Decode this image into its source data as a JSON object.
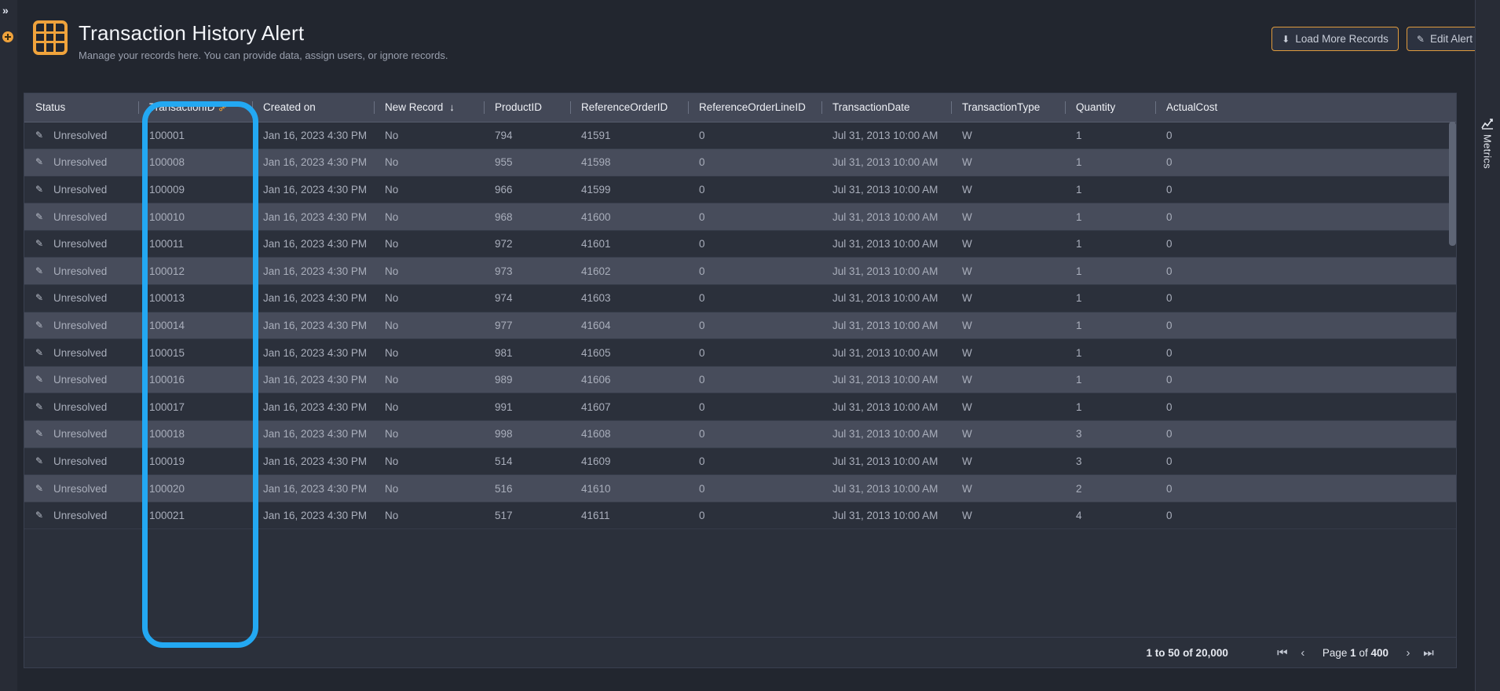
{
  "rail": {
    "expand_icon": "double-chevron-right",
    "expand_glyph": "»",
    "add_icon": "plus-circle"
  },
  "header": {
    "logo_icon": "grid-table-icon",
    "title": "Transaction History Alert",
    "subtitle": "Manage your records here. You can provide data, assign users, or ignore records.",
    "buttons": [
      {
        "label": "Load More Records",
        "icon": "download-circle-icon",
        "glyph": "⬇",
        "name": "load-more-records-button"
      },
      {
        "label": "Edit Alert",
        "icon": "edit-pencil-square-icon",
        "glyph": "✎",
        "name": "edit-alert-button"
      }
    ]
  },
  "table": {
    "columns": [
      {
        "key": "status",
        "label": "Status",
        "cls": "c-status",
        "icon": ""
      },
      {
        "key": "transaction_id",
        "label": "TransactionID",
        "cls": "c-txnid",
        "icon": "primary-key-icon"
      },
      {
        "key": "created_on",
        "label": "Created on",
        "cls": "c-created",
        "icon": ""
      },
      {
        "key": "new_record",
        "label": "New Record",
        "cls": "c-newrec",
        "icon": "sort-descending-arrow-icon"
      },
      {
        "key": "product_id",
        "label": "ProductID",
        "cls": "c-prodid",
        "icon": ""
      },
      {
        "key": "reference_order_id",
        "label": "ReferenceOrderID",
        "cls": "c-refoid",
        "icon": ""
      },
      {
        "key": "reference_order_line_id",
        "label": "ReferenceOrderLineID",
        "cls": "c-reflid",
        "icon": ""
      },
      {
        "key": "transaction_date",
        "label": "TransactionDate",
        "cls": "c-txndate",
        "icon": ""
      },
      {
        "key": "transaction_type",
        "label": "TransactionType",
        "cls": "c-txntype",
        "icon": ""
      },
      {
        "key": "quantity",
        "label": "Quantity",
        "cls": "c-qty",
        "icon": ""
      },
      {
        "key": "actual_cost",
        "label": "ActualCost",
        "cls": "c-cost",
        "icon": ""
      }
    ],
    "rows": [
      {
        "status": "Unresolved",
        "transaction_id": "100001",
        "created_on": "Jan 16, 2023 4:30 PM",
        "new_record": "No",
        "product_id": "794",
        "reference_order_id": "41591",
        "reference_order_line_id": "0",
        "transaction_date": "Jul 31, 2013 10:00 AM",
        "transaction_type": "W",
        "quantity": "1",
        "actual_cost": "0"
      },
      {
        "status": "Unresolved",
        "transaction_id": "100008",
        "created_on": "Jan 16, 2023 4:30 PM",
        "new_record": "No",
        "product_id": "955",
        "reference_order_id": "41598",
        "reference_order_line_id": "0",
        "transaction_date": "Jul 31, 2013 10:00 AM",
        "transaction_type": "W",
        "quantity": "1",
        "actual_cost": "0"
      },
      {
        "status": "Unresolved",
        "transaction_id": "100009",
        "created_on": "Jan 16, 2023 4:30 PM",
        "new_record": "No",
        "product_id": "966",
        "reference_order_id": "41599",
        "reference_order_line_id": "0",
        "transaction_date": "Jul 31, 2013 10:00 AM",
        "transaction_type": "W",
        "quantity": "1",
        "actual_cost": "0"
      },
      {
        "status": "Unresolved",
        "transaction_id": "100010",
        "created_on": "Jan 16, 2023 4:30 PM",
        "new_record": "No",
        "product_id": "968",
        "reference_order_id": "41600",
        "reference_order_line_id": "0",
        "transaction_date": "Jul 31, 2013 10:00 AM",
        "transaction_type": "W",
        "quantity": "1",
        "actual_cost": "0"
      },
      {
        "status": "Unresolved",
        "transaction_id": "100011",
        "created_on": "Jan 16, 2023 4:30 PM",
        "new_record": "No",
        "product_id": "972",
        "reference_order_id": "41601",
        "reference_order_line_id": "0",
        "transaction_date": "Jul 31, 2013 10:00 AM",
        "transaction_type": "W",
        "quantity": "1",
        "actual_cost": "0"
      },
      {
        "status": "Unresolved",
        "transaction_id": "100012",
        "created_on": "Jan 16, 2023 4:30 PM",
        "new_record": "No",
        "product_id": "973",
        "reference_order_id": "41602",
        "reference_order_line_id": "0",
        "transaction_date": "Jul 31, 2013 10:00 AM",
        "transaction_type": "W",
        "quantity": "1",
        "actual_cost": "0"
      },
      {
        "status": "Unresolved",
        "transaction_id": "100013",
        "created_on": "Jan 16, 2023 4:30 PM",
        "new_record": "No",
        "product_id": "974",
        "reference_order_id": "41603",
        "reference_order_line_id": "0",
        "transaction_date": "Jul 31, 2013 10:00 AM",
        "transaction_type": "W",
        "quantity": "1",
        "actual_cost": "0"
      },
      {
        "status": "Unresolved",
        "transaction_id": "100014",
        "created_on": "Jan 16, 2023 4:30 PM",
        "new_record": "No",
        "product_id": "977",
        "reference_order_id": "41604",
        "reference_order_line_id": "0",
        "transaction_date": "Jul 31, 2013 10:00 AM",
        "transaction_type": "W",
        "quantity": "1",
        "actual_cost": "0"
      },
      {
        "status": "Unresolved",
        "transaction_id": "100015",
        "created_on": "Jan 16, 2023 4:30 PM",
        "new_record": "No",
        "product_id": "981",
        "reference_order_id": "41605",
        "reference_order_line_id": "0",
        "transaction_date": "Jul 31, 2013 10:00 AM",
        "transaction_type": "W",
        "quantity": "1",
        "actual_cost": "0"
      },
      {
        "status": "Unresolved",
        "transaction_id": "100016",
        "created_on": "Jan 16, 2023 4:30 PM",
        "new_record": "No",
        "product_id": "989",
        "reference_order_id": "41606",
        "reference_order_line_id": "0",
        "transaction_date": "Jul 31, 2013 10:00 AM",
        "transaction_type": "W",
        "quantity": "1",
        "actual_cost": "0"
      },
      {
        "status": "Unresolved",
        "transaction_id": "100017",
        "created_on": "Jan 16, 2023 4:30 PM",
        "new_record": "No",
        "product_id": "991",
        "reference_order_id": "41607",
        "reference_order_line_id": "0",
        "transaction_date": "Jul 31, 2013 10:00 AM",
        "transaction_type": "W",
        "quantity": "1",
        "actual_cost": "0"
      },
      {
        "status": "Unresolved",
        "transaction_id": "100018",
        "created_on": "Jan 16, 2023 4:30 PM",
        "new_record": "No",
        "product_id": "998",
        "reference_order_id": "41608",
        "reference_order_line_id": "0",
        "transaction_date": "Jul 31, 2013 10:00 AM",
        "transaction_type": "W",
        "quantity": "3",
        "actual_cost": "0"
      },
      {
        "status": "Unresolved",
        "transaction_id": "100019",
        "created_on": "Jan 16, 2023 4:30 PM",
        "new_record": "No",
        "product_id": "514",
        "reference_order_id": "41609",
        "reference_order_line_id": "0",
        "transaction_date": "Jul 31, 2013 10:00 AM",
        "transaction_type": "W",
        "quantity": "3",
        "actual_cost": "0"
      },
      {
        "status": "Unresolved",
        "transaction_id": "100020",
        "created_on": "Jan 16, 2023 4:30 PM",
        "new_record": "No",
        "product_id": "516",
        "reference_order_id": "41610",
        "reference_order_line_id": "0",
        "transaction_date": "Jul 31, 2013 10:00 AM",
        "transaction_type": "W",
        "quantity": "2",
        "actual_cost": "0"
      },
      {
        "status": "Unresolved",
        "transaction_id": "100021",
        "created_on": "Jan 16, 2023 4:30 PM",
        "new_record": "No",
        "product_id": "517",
        "reference_order_id": "41611",
        "reference_order_line_id": "0",
        "transaction_date": "Jul 31, 2013 10:00 AM",
        "transaction_type": "W",
        "quantity": "4",
        "actual_cost": "0"
      }
    ]
  },
  "footer": {
    "range_label": "1 to 50 of 20,000",
    "page_prefix": "Page",
    "page_current": "1",
    "page_of": "of",
    "page_total": "400",
    "first_glyph": "⏮",
    "prev_glyph": "‹",
    "next_glyph": "›",
    "last_glyph": "⏭"
  },
  "right_rail": {
    "metrics_label": "Metrics",
    "metrics_icon": "line-chart-icon"
  },
  "annotation": {
    "target_column": "TransactionID",
    "color": "#23a8f2"
  },
  "colors": {
    "accent_orange": "#f0a33c",
    "annotation_cyan": "#23a8f2",
    "header_row": "#434857",
    "row_odd": "#2b303b",
    "row_even": "#474c5b",
    "page_bg": "#22262f"
  }
}
